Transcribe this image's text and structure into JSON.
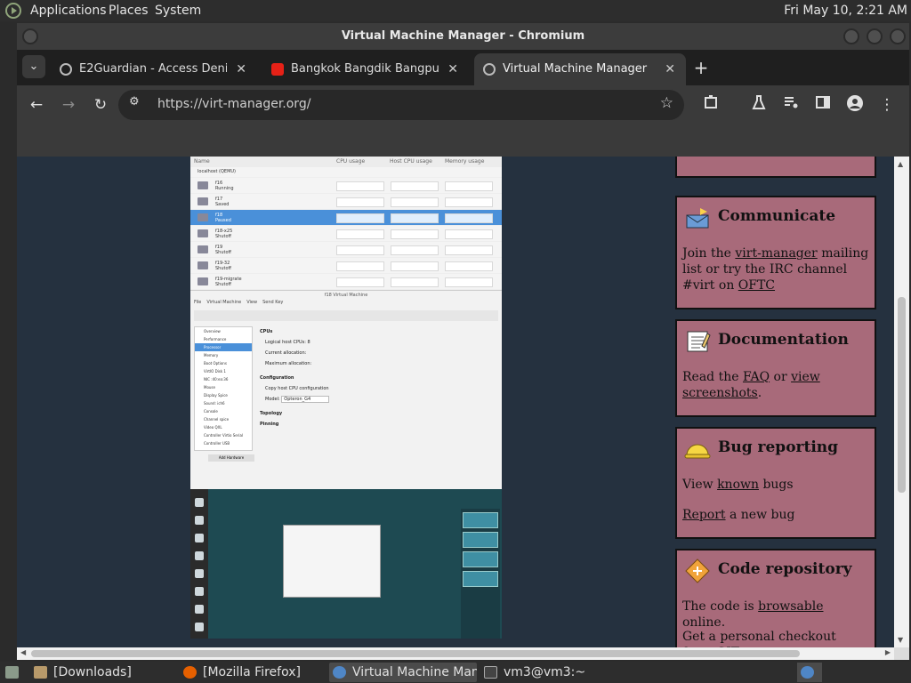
{
  "topbar": {
    "menus": [
      "Applications",
      "Places",
      "System"
    ],
    "clock": "Fri May 10,  2:21 AM"
  },
  "window": {
    "title": "Virtual Machine Manager - Chromium"
  },
  "tabs": [
    {
      "title": "E2Guardian - Access Denied",
      "close": "✕"
    },
    {
      "title": "Bangkok Bangdik Bangpusi Ba",
      "close": "✕"
    },
    {
      "title": "Virtual Machine Manager",
      "close": "✕"
    }
  ],
  "tabstrip": {
    "menu_glyph": "⌄",
    "new_tab_glyph": "+"
  },
  "toolbar": {
    "back": "←",
    "forward": "→",
    "reload": "↻",
    "url": "https://virt-manager.org/",
    "star": "☆",
    "tune": "⚙"
  },
  "vm_screenshot": {
    "headers": [
      "Name",
      "CPU usage",
      "Host CPU usage",
      "Memory usage"
    ],
    "group": "localhost (QEMU)",
    "rows": [
      {
        "name": "f16",
        "state": "Running"
      },
      {
        "name": "f17",
        "state": "Saved"
      },
      {
        "name": "f18",
        "state": "Paused"
      },
      {
        "name": "f18-x25",
        "state": "Shutoff"
      },
      {
        "name": "f19",
        "state": "Shutoff"
      },
      {
        "name": "f19-32",
        "state": "Shutoff"
      },
      {
        "name": "f19-migrate",
        "state": "Shutoff"
      }
    ],
    "details_title": "f18 Virtual Machine",
    "details_menu": [
      "File",
      "Virtual Machine",
      "View",
      "Send Key"
    ],
    "details_items": [
      "Overview",
      "Performance",
      "Processor",
      "Memory",
      "Boot Options",
      "VirtIO Disk 1",
      "NIC :40:ea:36",
      "Mouse",
      "Display Spice",
      "Sound: ich6",
      "Console",
      "Channel spice",
      "Video QXL",
      "Controller Virtio Serial",
      "Controller USB"
    ],
    "add_hardware": "Add Hardware",
    "cpus_label": "CPUs",
    "logical_cpus": "Logical host CPUs:  8",
    "current_alloc": "Current allocation:",
    "max_alloc": "Maximum allocation:",
    "configuration": "Configuration",
    "copy_host": "Copy host CPU configuration",
    "model": "Model:",
    "model_value": "Opteron_G4",
    "topology": "Topology",
    "pinning": "Pinning"
  },
  "sidebar": [
    {
      "title": "Communicate",
      "text": [
        "Join the ",
        "virt-manager",
        " mailing list or try the IRC channel #virt on ",
        "OFTC"
      ]
    },
    {
      "title": "Documentation",
      "text": [
        "Read the ",
        "FAQ",
        " or ",
        "view screenshots",
        "."
      ]
    },
    {
      "title": "Bug reporting",
      "line1": [
        "View ",
        "known",
        " bugs"
      ],
      "line2": [
        "Report",
        " a new bug"
      ]
    },
    {
      "title": "Code repository",
      "line1": [
        "The code is ",
        "browsable",
        " online."
      ],
      "line2": "Get a personal checkout from GIT"
    }
  ],
  "taskbar": [
    {
      "label": "[Downloads]"
    },
    {
      "label": "[Mozilla Firefox]"
    },
    {
      "label": "Virtual Machine Man..."
    },
    {
      "label": "vm3@vm3:~"
    }
  ],
  "colors": {
    "sidebar_box": "#a86a7a",
    "content_bg": "#25313f",
    "chrome_dark": "#3a3a3a"
  }
}
